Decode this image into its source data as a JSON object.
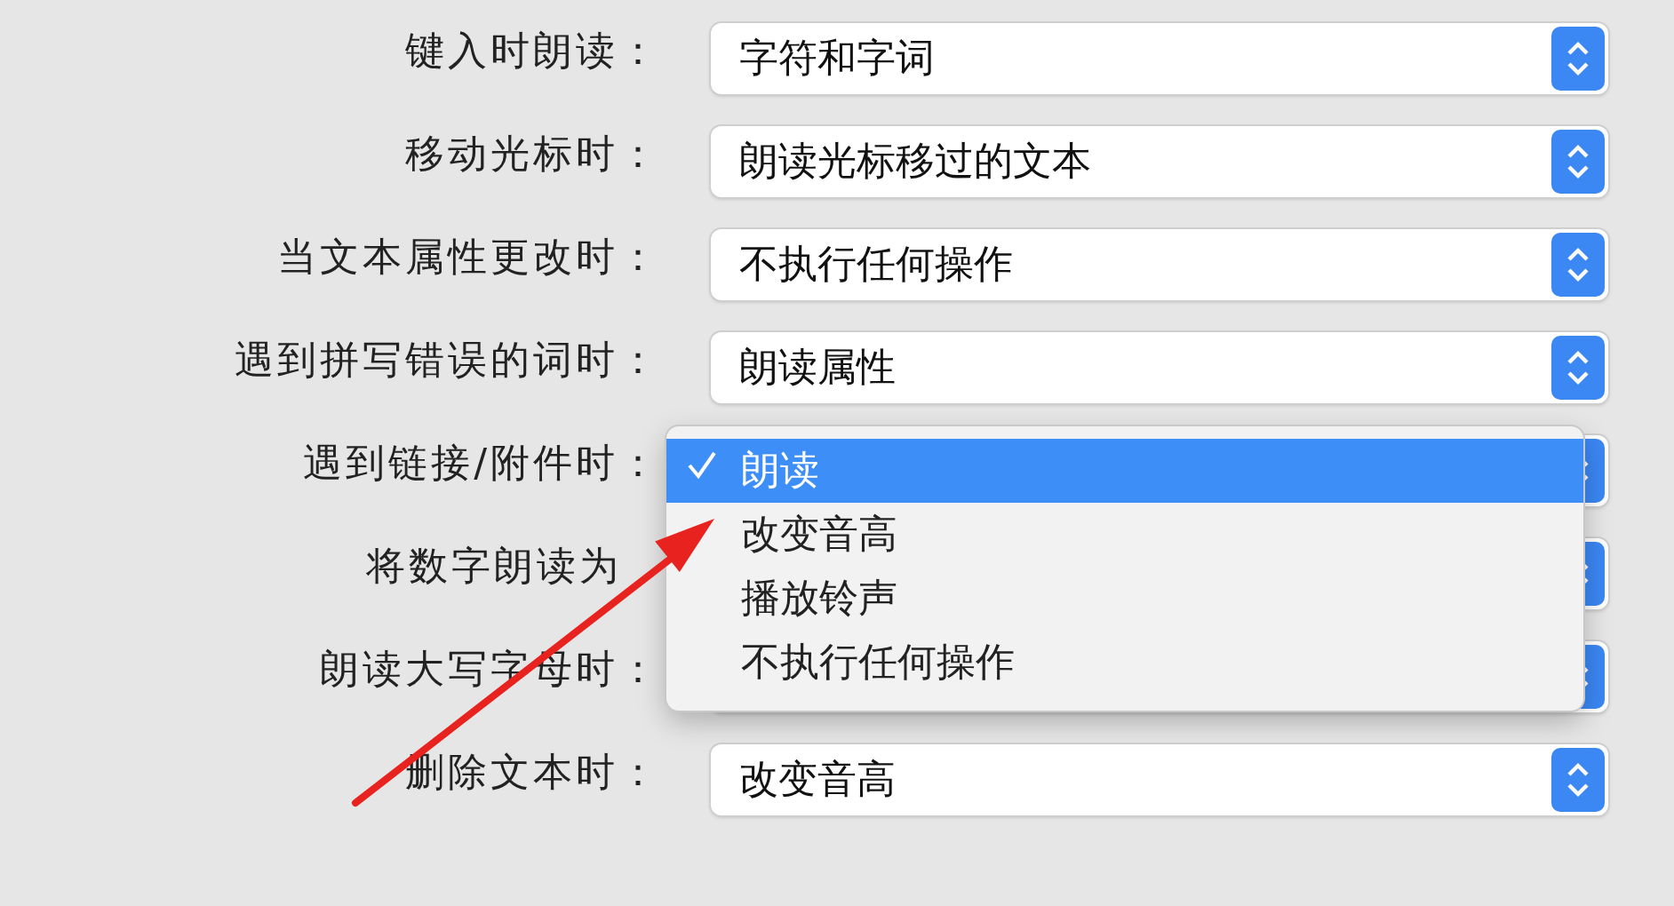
{
  "rows": [
    {
      "label": "键入时朗读：",
      "value": "字符和字词"
    },
    {
      "label": "移动光标时：",
      "value": "朗读光标移过的文本"
    },
    {
      "label": "当文本属性更改时：",
      "value": "不执行任何操作"
    },
    {
      "label": "遇到拼写错误的词时：",
      "value": "朗读属性"
    },
    {
      "label": "遇到链接/附件时："
    },
    {
      "label": "将数字朗读为",
      "colon_covered": true
    },
    {
      "label": "朗读大写字母时："
    },
    {
      "label": "删除文本时：",
      "value": "改变音高"
    }
  ],
  "dropdown_menu": {
    "items": [
      {
        "label": "朗读",
        "selected": true
      },
      {
        "label": "改变音高",
        "selected": false
      },
      {
        "label": "播放铃声",
        "selected": false
      },
      {
        "label": "不执行任何操作",
        "selected": false
      }
    ]
  },
  "annotation": {
    "kind": "arrow"
  }
}
